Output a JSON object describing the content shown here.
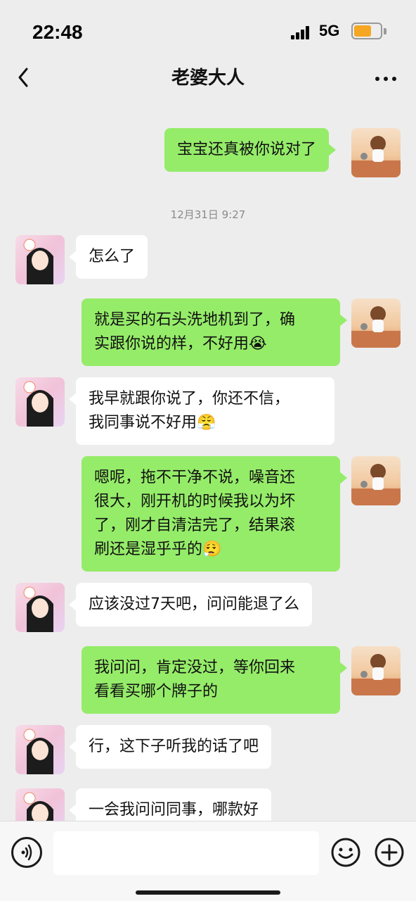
{
  "status_bar": {
    "time": "22:48",
    "network": "5G",
    "battery_color": "#f5a623"
  },
  "header": {
    "title": "老婆大人",
    "back_icon": "chevron-left-icon",
    "more_icon": "more-dots-icon"
  },
  "messages": [
    {
      "sender": "me",
      "text": "宝宝还真被你说对了"
    },
    {
      "timestamp": "12月31日 9:27"
    },
    {
      "sender": "her",
      "text": "怎么了"
    },
    {
      "sender": "me",
      "lines": [
        "就是买的石头洗地机到了，确",
        "实跟你说的样，不好用😭"
      ]
    },
    {
      "sender": "her",
      "lines": [
        "我早就跟你说了，你还不信，",
        "我同事说不好用😤"
      ]
    },
    {
      "sender": "me",
      "lines": [
        "嗯呢，拖不干净不说，噪音还",
        "很大，刚开机的时候我以为坏",
        "了，刚才自清洁完了，结果滚",
        "刷还是湿乎乎的😮‍💨"
      ]
    },
    {
      "sender": "her",
      "text": "应该没过7天吧，问问能退了么"
    },
    {
      "sender": "me",
      "lines": [
        "我问问，肯定没过，等你回来",
        "看看买哪个牌子的"
      ]
    },
    {
      "sender": "her",
      "text": "行，这下子听我的话了吧"
    },
    {
      "sender": "her",
      "text": "一会我问问同事，哪款好"
    }
  ],
  "colors": {
    "my_bubble": "#95ec69",
    "her_bubble": "#ffffff",
    "background": "#ededed"
  },
  "input_bar": {
    "voice_icon": "voice-icon",
    "emoji_icon": "emoji-icon",
    "plus_icon": "plus-icon",
    "value": ""
  }
}
